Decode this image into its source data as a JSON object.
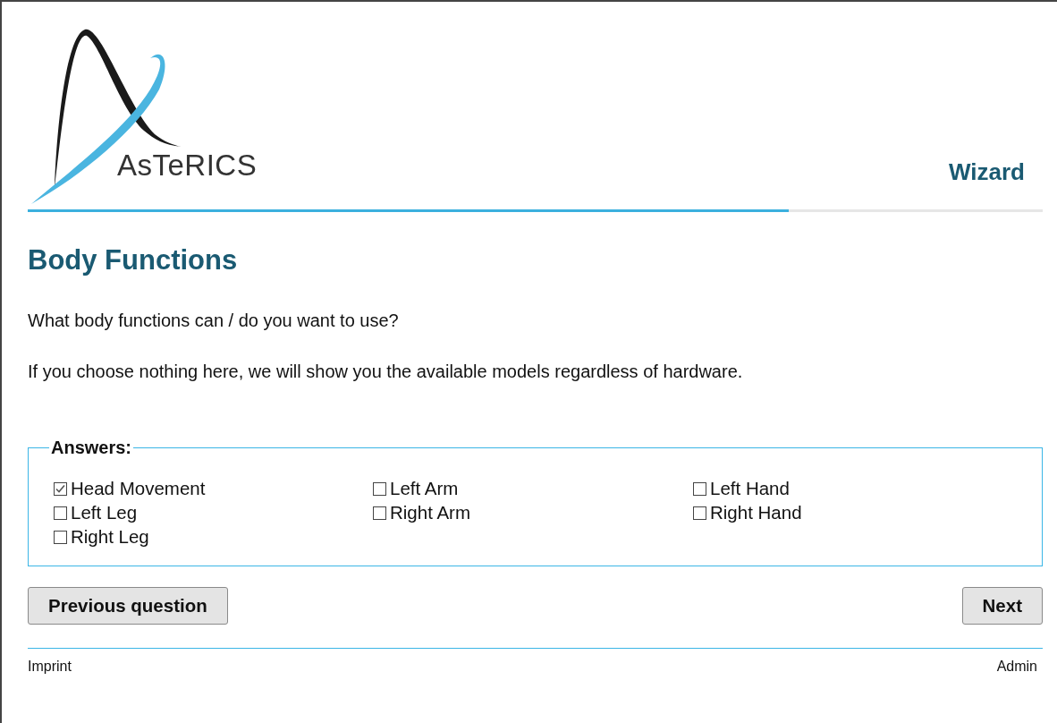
{
  "logo": {
    "text": "AsTeRICS"
  },
  "header": {
    "title": "Wizard"
  },
  "progress": {
    "level": 0.75
  },
  "heading": "Body Functions",
  "question": "What body functions can / do you want to use?",
  "hint": "If you choose nothing here, we will show you the available models regardless of hardware.",
  "answers": {
    "legend": "Answers:",
    "options": [
      {
        "label": "Head Movement",
        "checked": true
      },
      {
        "label": "Left Arm",
        "checked": false
      },
      {
        "label": "Left Hand",
        "checked": false
      },
      {
        "label": "Left Leg",
        "checked": false
      },
      {
        "label": "Right Arm",
        "checked": false
      },
      {
        "label": "Right Hand",
        "checked": false
      },
      {
        "label": "Right Leg",
        "checked": false
      }
    ]
  },
  "buttons": {
    "previous": "Previous question",
    "next": "Next"
  },
  "footer": {
    "left": "Imprint",
    "right": "Admin"
  }
}
